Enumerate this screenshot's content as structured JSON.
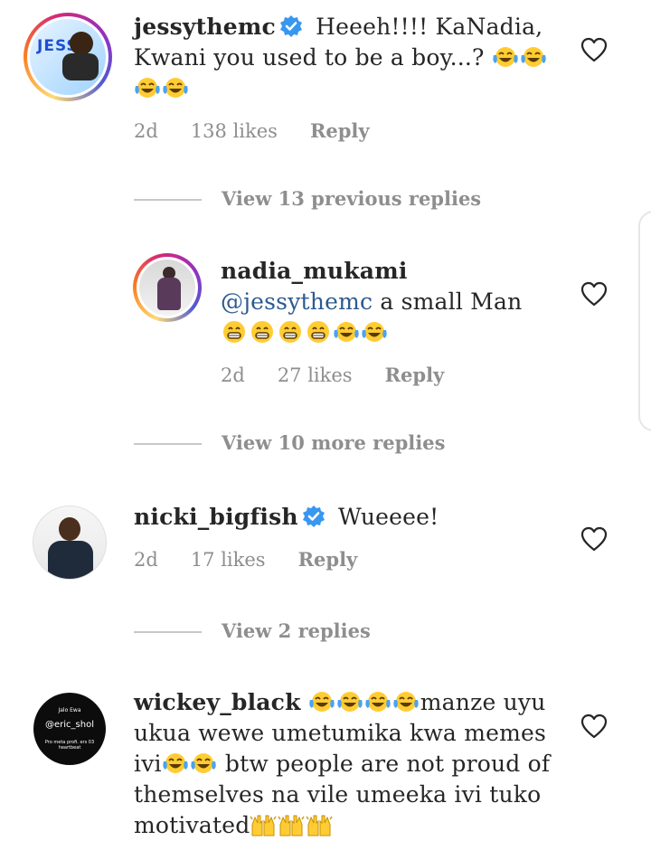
{
  "comments": [
    {
      "username": "jessythemc",
      "verified": true,
      "text_line1": "Heeeh!!!! KaNadia,",
      "text_line2": "Kwani you used to be a boy...?",
      "emoji_label": "😂",
      "time": "2d",
      "likes": "138 likes",
      "reply": "Reply",
      "view_replies": "View 13 previous replies",
      "avatar_text": "JESSY"
    },
    {
      "username": "nadia_mukami",
      "mention": "@jessythemc",
      "text": "a small Man",
      "time": "2d",
      "likes": "27 likes",
      "reply": "Reply",
      "view_replies": "View 10 more replies"
    },
    {
      "username": "nicki_bigfish",
      "verified": true,
      "text": "Wueeee!",
      "time": "2d",
      "likes": "17 likes",
      "reply": "Reply",
      "view_replies": "View 2 replies"
    },
    {
      "username": "wickey_black",
      "text_line1": "manze uyu",
      "text_line2": "ukua wewe umetumika kwa memes",
      "text_line3_a": "ivi",
      "text_line3_b": "btw people are not proud of",
      "text_line4": "themselves na vile umeeka ivi tuko",
      "text_line5": "motivated",
      "avatar_line1": "Jalo Ewa",
      "avatar_line2": "@eric_shol",
      "avatar_line3": "Pro meta profi. ers 03 heartbeat"
    }
  ],
  "colors": {
    "text": "#262626",
    "meta": "#8e8e8e",
    "mention": "#2c5a8f",
    "verified": "#3897f0"
  },
  "icons": [
    "heart-outline-icon",
    "verified-badge-icon",
    "laughing-tears-emoji",
    "grinning-emoji",
    "raising-hands-emoji"
  ]
}
